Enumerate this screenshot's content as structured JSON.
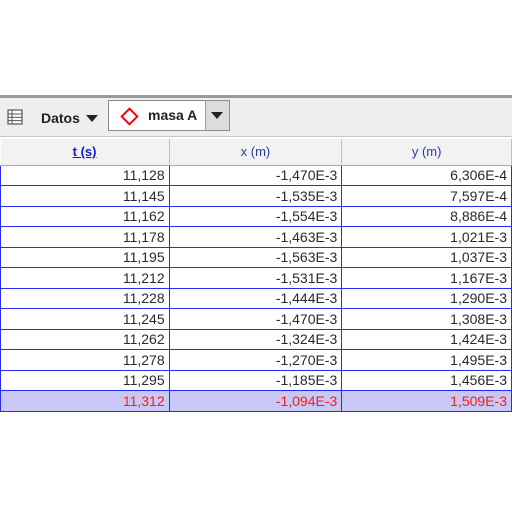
{
  "toolbar": {
    "table_icon": "table-grid-icon",
    "data_menu_label": "Datos",
    "data_menu_icon": "chevron-down-icon",
    "object_selector": {
      "selected": "masa A",
      "icon": "diamond-icon",
      "icon_color": "#e01010"
    }
  },
  "table": {
    "columns": [
      "t (s)",
      "x (m)",
      "y (m)"
    ],
    "sorted_column": "t (s)",
    "rows": [
      [
        "11,128",
        "-1,470E-3",
        "6,306E-4"
      ],
      [
        "11,145",
        "-1,535E-3",
        "7,597E-4"
      ],
      [
        "11,162",
        "-1,554E-3",
        "8,886E-4"
      ],
      [
        "11,178",
        "-1,463E-3",
        "1,021E-3"
      ],
      [
        "11,195",
        "-1,563E-3",
        "1,037E-3"
      ],
      [
        "11,212",
        "-1,531E-3",
        "1,167E-3"
      ],
      [
        "11,228",
        "-1,444E-3",
        "1,290E-3"
      ],
      [
        "11,245",
        "-1,470E-3",
        "1,308E-3"
      ],
      [
        "11,262",
        "-1,324E-3",
        "1,424E-3"
      ],
      [
        "11,278",
        "-1,270E-3",
        "1,495E-3"
      ],
      [
        "11,295",
        "-1,185E-3",
        "1,456E-3"
      ],
      [
        "11,312",
        "-1,094E-3",
        "1,509E-3"
      ]
    ],
    "selected_row_index": 11,
    "colors": {
      "grid_line": "#2a2af0",
      "selected_bg": "#c9c7f3",
      "selected_text": "#ff1a1a",
      "header_text": "#2b3aa0"
    }
  }
}
